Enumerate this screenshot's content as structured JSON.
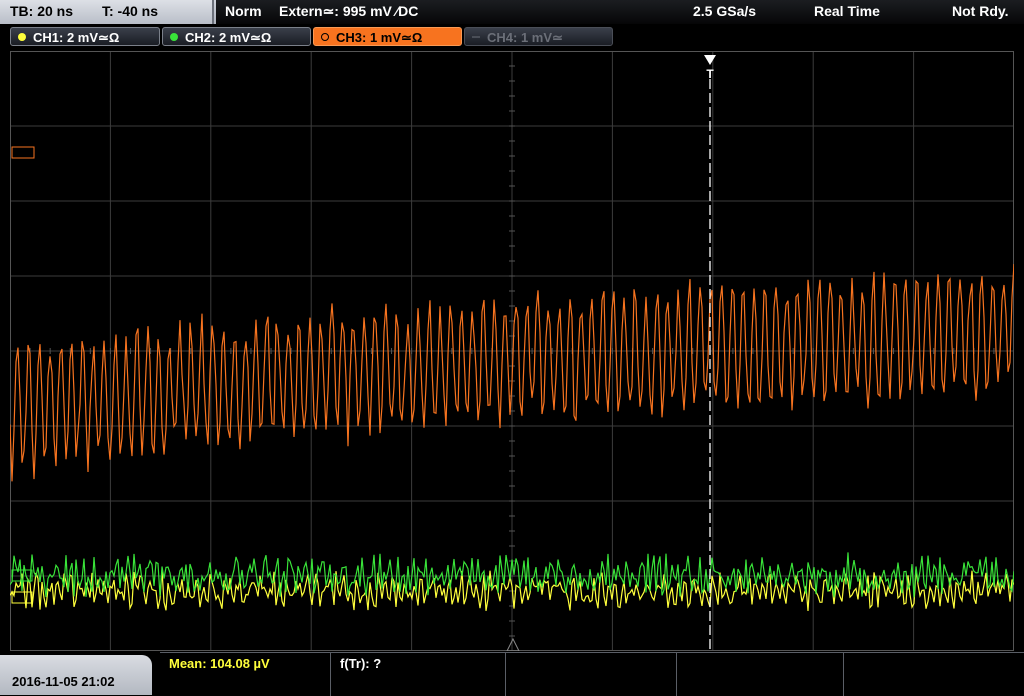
{
  "topbar": {
    "timebase": "TB: 20 ns",
    "trigger_time": "T: -40 ns",
    "acq_mode": "Norm",
    "trigger_source": "Extern≃: 995 mV ∕DC",
    "sample_rate": "2.5 GSa/s",
    "display_mode": "Real Time",
    "status": "Not Rdy."
  },
  "channels": [
    {
      "label": "CH1: 2 mV≃Ω",
      "color": "#ffff3c",
      "state": "on"
    },
    {
      "label": "CH2: 2 mV≃Ω",
      "color": "#39e339",
      "state": "on"
    },
    {
      "label": "CH3: 1 mV≃Ω",
      "color": "#f7731f",
      "state": "active"
    },
    {
      "label": "CH4: 1 mV≃",
      "color": "#6b6f78",
      "state": "off"
    }
  ],
  "scope": {
    "grid_color": "#3c3c3c",
    "trigger_marker": "T",
    "ch3_marker": "‣"
  },
  "bottom": {
    "datetime": "2016-11-05 21:02",
    "mean": "Mean: 104.08 µV",
    "f_tr": "f(Tr): ?"
  }
}
